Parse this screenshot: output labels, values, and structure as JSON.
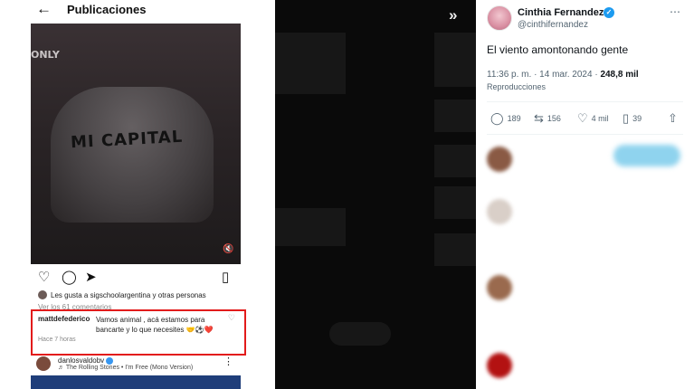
{
  "instagram": {
    "back_icon": "arrow-left-icon",
    "title": "Publicaciones",
    "photo_shirt_text": "MI CAPITAL",
    "photo_top_text": "ONLY",
    "mute_icon": "speaker-muted-icon",
    "actions": [
      "heart-icon",
      "comment-icon",
      "send-icon",
      "bookmark-icon"
    ],
    "likes_text": "Les gusta a sigschoolargentina y otras personas",
    "view_comments": "Ver los 61 comentarios",
    "highlight_color": "#e21b1b",
    "comment": {
      "user": "mattdefederico",
      "text": "Vamos animal , acá estamos para bancarte y lo que necesites 🤝⚽❤️",
      "time": "Hace 7 horas"
    },
    "next_post": {
      "user": "danlosvaldobv",
      "song": "♬ The Rolling Stones • I'm Free (Mono Version)"
    }
  },
  "tweet": {
    "name": "Cinthia Fernandez",
    "handle": "@cinthifernandez",
    "more_icon": "more-horizontal-icon",
    "text": "El viento amontonando gente",
    "datetime": "11:36 p. m. · 14 mar. 2024 ·",
    "views": "248,8 mil",
    "views_label": "Reproducciones",
    "stats": {
      "replies": "189",
      "retweets": "156",
      "likes": "4 mil",
      "bookmarks": "39"
    },
    "accent": "#1d9bf0"
  },
  "overlay": {
    "expand_icon": "chevrons-right-icon"
  }
}
